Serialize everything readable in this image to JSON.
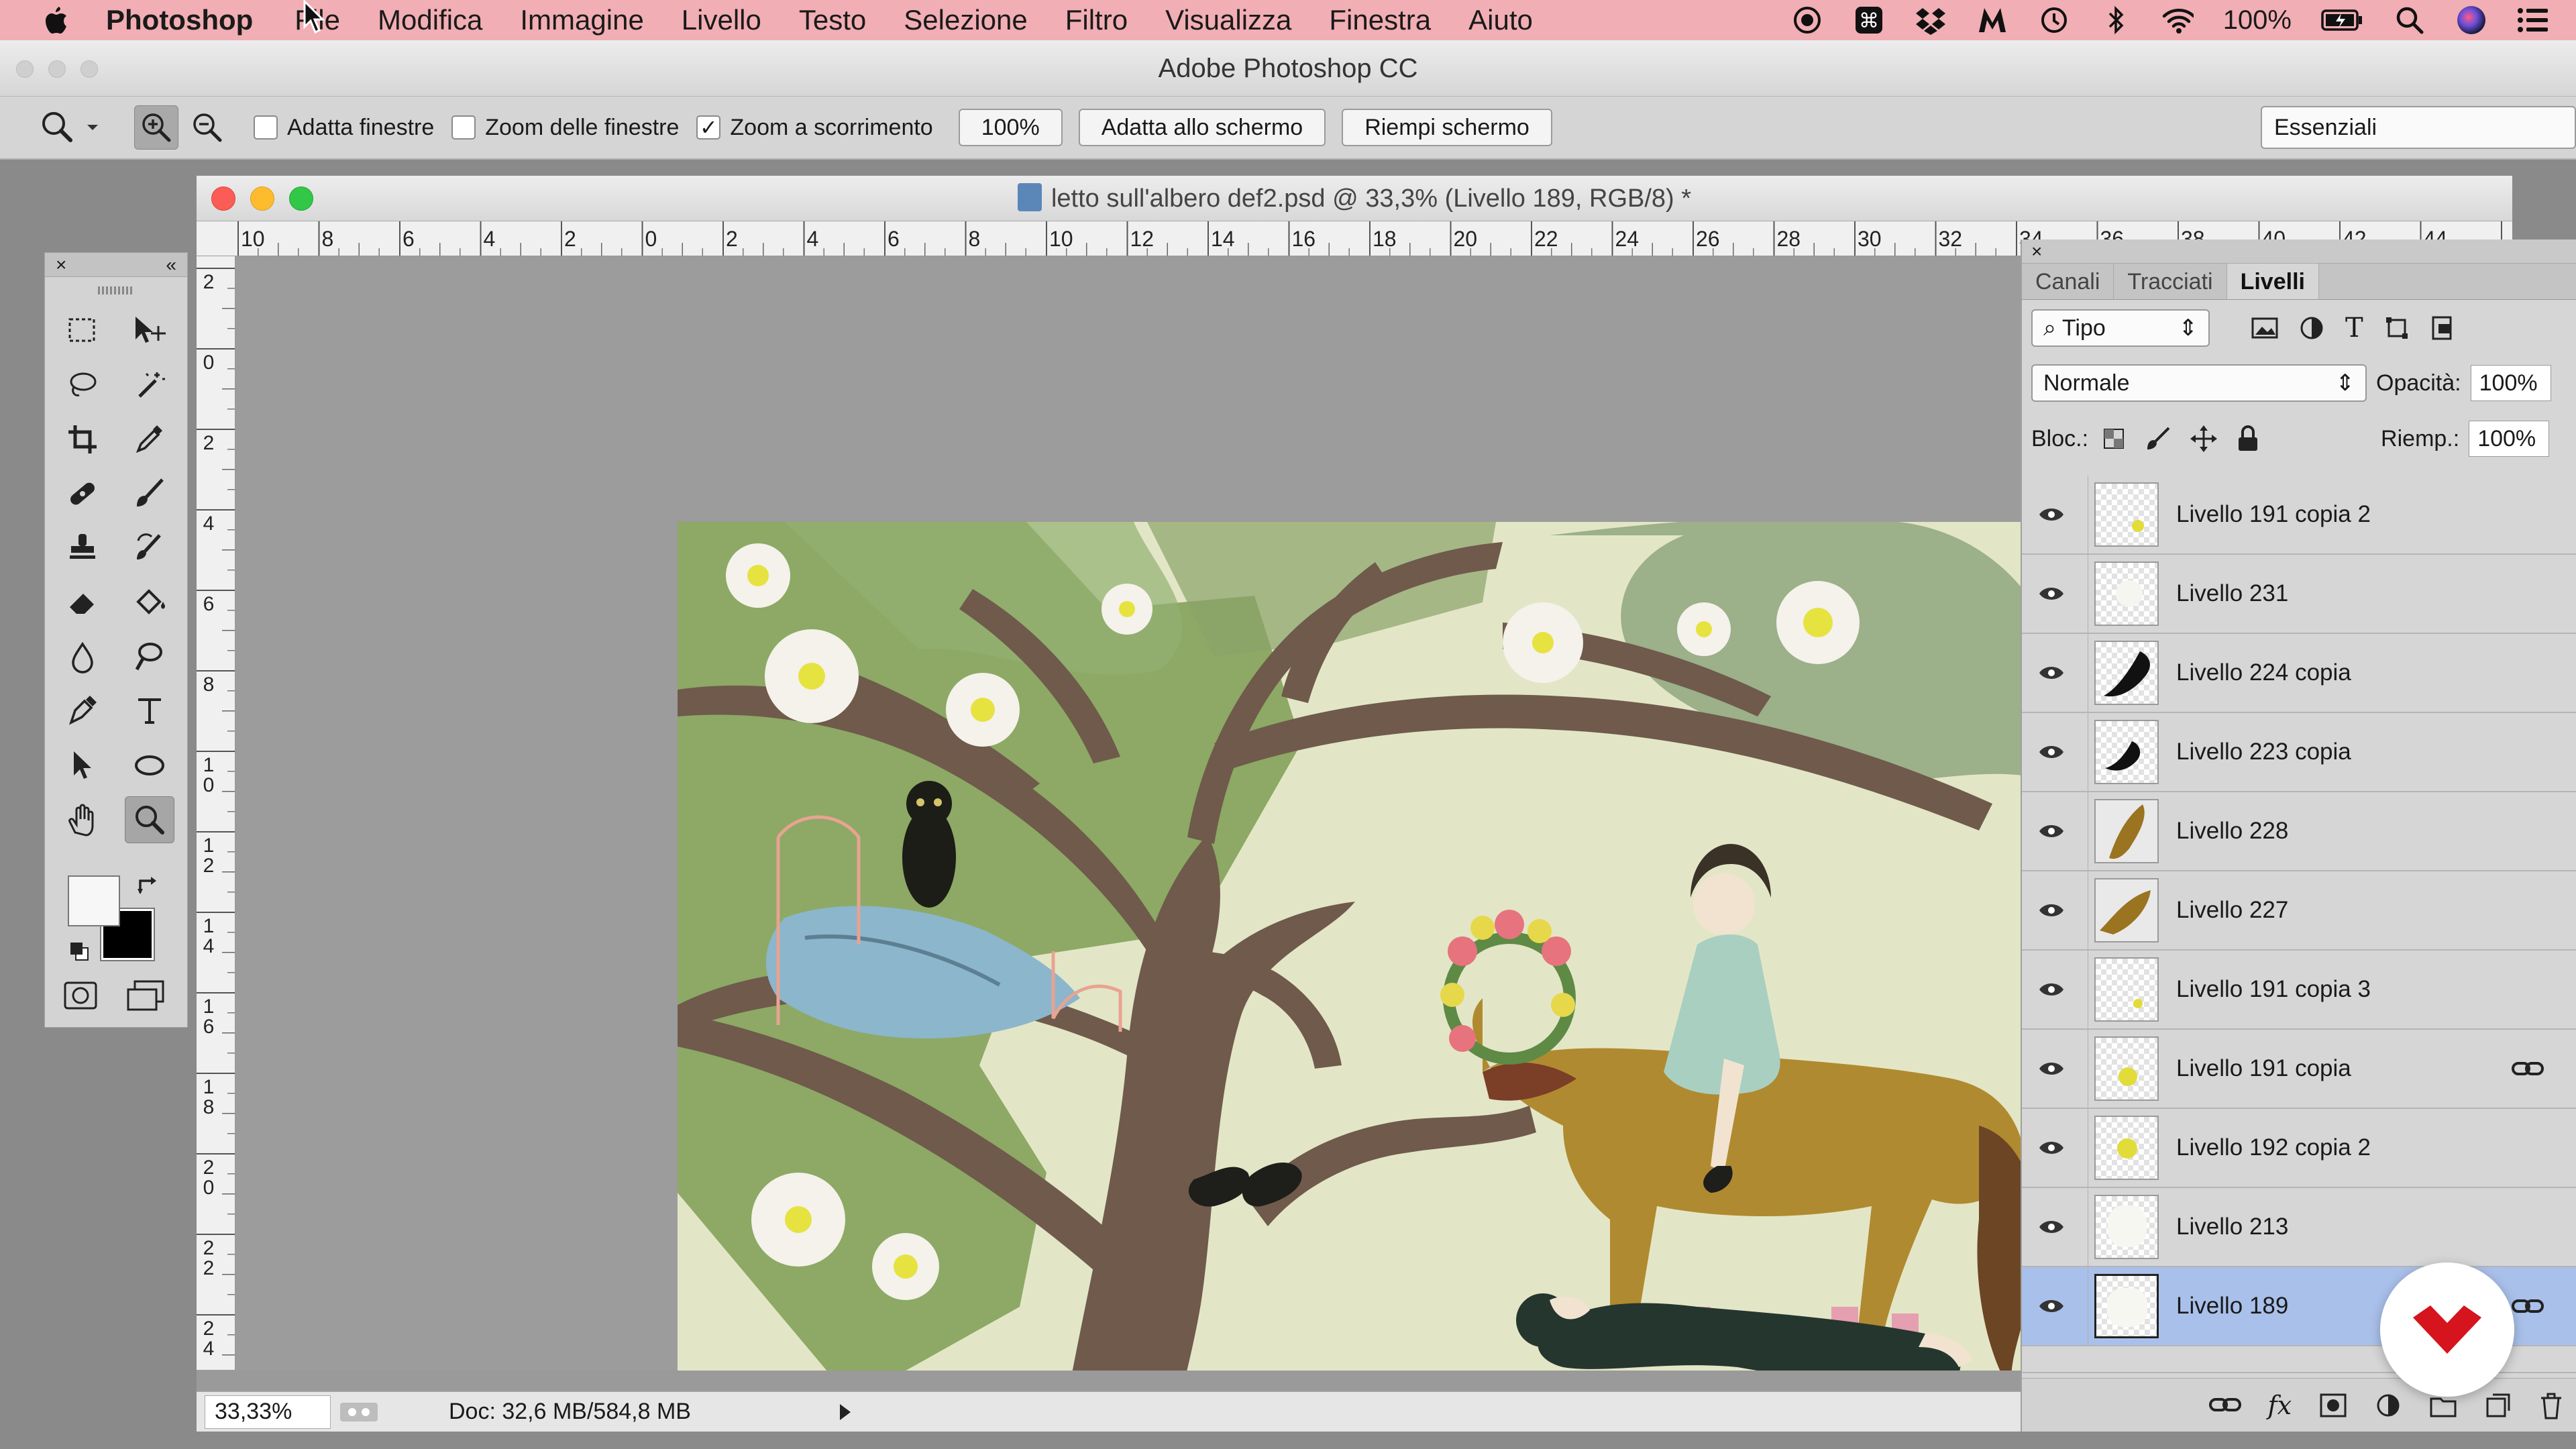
{
  "menubar": {
    "items": [
      "Photoshop",
      "File",
      "Modifica",
      "Immagine",
      "Livello",
      "Testo",
      "Selezione",
      "Filtro",
      "Visualizza",
      "Finestra",
      "Aiuto"
    ],
    "battery": "100%",
    "icons": [
      "apple-icon",
      "record-icon",
      "command-icon",
      "dropbox-icon",
      "m-app-icon",
      "time-machine-icon",
      "bluetooth-icon",
      "wifi-icon",
      "battery-icon",
      "search-icon",
      "siri-icon",
      "list-icon"
    ]
  },
  "app_title": "Adobe Photoshop CC",
  "options": {
    "resize_windows": "Adatta finestre",
    "resize_windows_checked": false,
    "zoom_all_windows": "Zoom delle finestre",
    "zoom_all_windows_checked": false,
    "scrubby_zoom": "Zoom a scorrimento",
    "scrubby_zoom_checked": true,
    "check_mark": "✓",
    "zoom_100": "100%",
    "fit_screen": "Adatta allo schermo",
    "fill_screen": "Riempi schermo",
    "workspace": "Essenziali"
  },
  "document": {
    "title": "letto sull'albero def2.psd @ 33,3% (Livello 189, RGB/8) *",
    "ruler_top": [
      "10",
      "8",
      "6",
      "4",
      "2",
      "0",
      "2",
      "4",
      "6",
      "8",
      "10",
      "12",
      "14",
      "16",
      "18",
      "20",
      "22",
      "24",
      "26",
      "28",
      "30",
      "32",
      "34",
      "36",
      "38",
      "40",
      "42",
      "44"
    ],
    "ruler_left": [
      "2",
      "0",
      "2",
      "4",
      "6",
      "8",
      "1 0",
      "1 2",
      "1 4",
      "1 6",
      "1 8",
      "2 0",
      "2 2",
      "2 4"
    ],
    "zoom": "33,33%",
    "doc_info": "Doc: 32,6 MB/584,8 MB"
  },
  "tools_panel": {
    "close": "×",
    "collapse": "«"
  },
  "layers_panel": {
    "close": "×",
    "tabs": [
      "Canali",
      "Tracciati",
      "Livelli"
    ],
    "active_tab": "Livelli",
    "filter_kind": "Tipo",
    "blend_mode": "Normale",
    "opacity_label": "Opacità:",
    "opacity": "100%",
    "lock_label": "Bloc.:",
    "fill_label": "Riemp.:",
    "fill": "100%",
    "layers": [
      {
        "name": "Livello 191 copia 2",
        "linked": false,
        "selected": false
      },
      {
        "name": "Livello 231",
        "linked": false,
        "selected": false
      },
      {
        "name": "Livello 224 copia",
        "linked": false,
        "selected": false
      },
      {
        "name": "Livello 223 copia",
        "linked": false,
        "selected": false
      },
      {
        "name": "Livello 228",
        "linked": false,
        "selected": false
      },
      {
        "name": "Livello 227",
        "linked": false,
        "selected": false
      },
      {
        "name": "Livello 191 copia 3",
        "linked": false,
        "selected": false
      },
      {
        "name": "Livello 191 copia",
        "linked": true,
        "selected": false
      },
      {
        "name": "Livello 192 copia 2",
        "linked": false,
        "selected": false
      },
      {
        "name": "Livello 213",
        "linked": false,
        "selected": false
      },
      {
        "name": "Livello 189",
        "linked": true,
        "selected": true
      }
    ],
    "footer_icons": [
      "link-layers-icon",
      "fx-icon",
      "add-mask-icon",
      "adjustment-icon",
      "group-icon",
      "new-layer-icon",
      "trash-icon"
    ],
    "fx": "fx"
  },
  "colors": {
    "menubar": "#f1aeb4",
    "selection": "#a9c0ea",
    "canvas_bg": "#e3e6c6",
    "tree": "#6f5a4c",
    "foliage": "#86a45c",
    "horse": "#b08a30",
    "badge": "#d5141e"
  }
}
